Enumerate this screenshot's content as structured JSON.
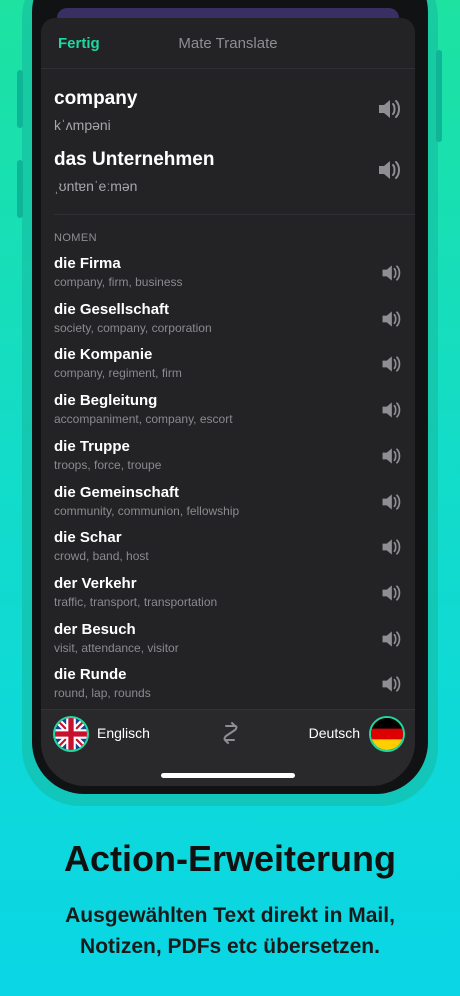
{
  "nav": {
    "done_label": "Fertig",
    "title": "Mate Translate"
  },
  "source": {
    "word": "company",
    "phonetic": "kˈʌmpəni"
  },
  "translation": {
    "word": "das Unternehmen",
    "phonetic": "ˌʊntɐnˈeːmən"
  },
  "section_label": "NOMEN",
  "entries": [
    {
      "word": "die Firma",
      "synonyms": "company, firm, business"
    },
    {
      "word": "die Gesellschaft",
      "synonyms": "society, company, corporation"
    },
    {
      "word": "die Kompanie",
      "synonyms": "company, regiment, firm"
    },
    {
      "word": "die Begleitung",
      "synonyms": "accompaniment, company, escort"
    },
    {
      "word": "die Truppe",
      "synonyms": "troops, force, troupe"
    },
    {
      "word": "die Gemeinschaft",
      "synonyms": "community, communion, fellowship"
    },
    {
      "word": "die Schar",
      "synonyms": "crowd, band, host"
    },
    {
      "word": "der Verkehr",
      "synonyms": "traffic, transport, transportation"
    },
    {
      "word": "der Besuch",
      "synonyms": "visit, attendance, visitor"
    },
    {
      "word": "die Runde",
      "synonyms": "round, lap, rounds"
    }
  ],
  "languages": {
    "from": "Englisch",
    "to": "Deutsch"
  },
  "promo": {
    "headline": "Action-Erweiterung",
    "line1": "Ausgewählten Text direkt in Mail,",
    "line2": "Notizen, PDFs etc übersetzen."
  },
  "colors": {
    "accent": "#1fd8a0",
    "panel": "#232326",
    "bg_top": "#1de2a0",
    "bg_bottom": "#0ad6e6"
  },
  "icons": {
    "speaker": "speaker-icon",
    "swap": "swap-icon",
    "flag_from": "uk-flag-icon",
    "flag_to": "germany-flag-icon"
  }
}
